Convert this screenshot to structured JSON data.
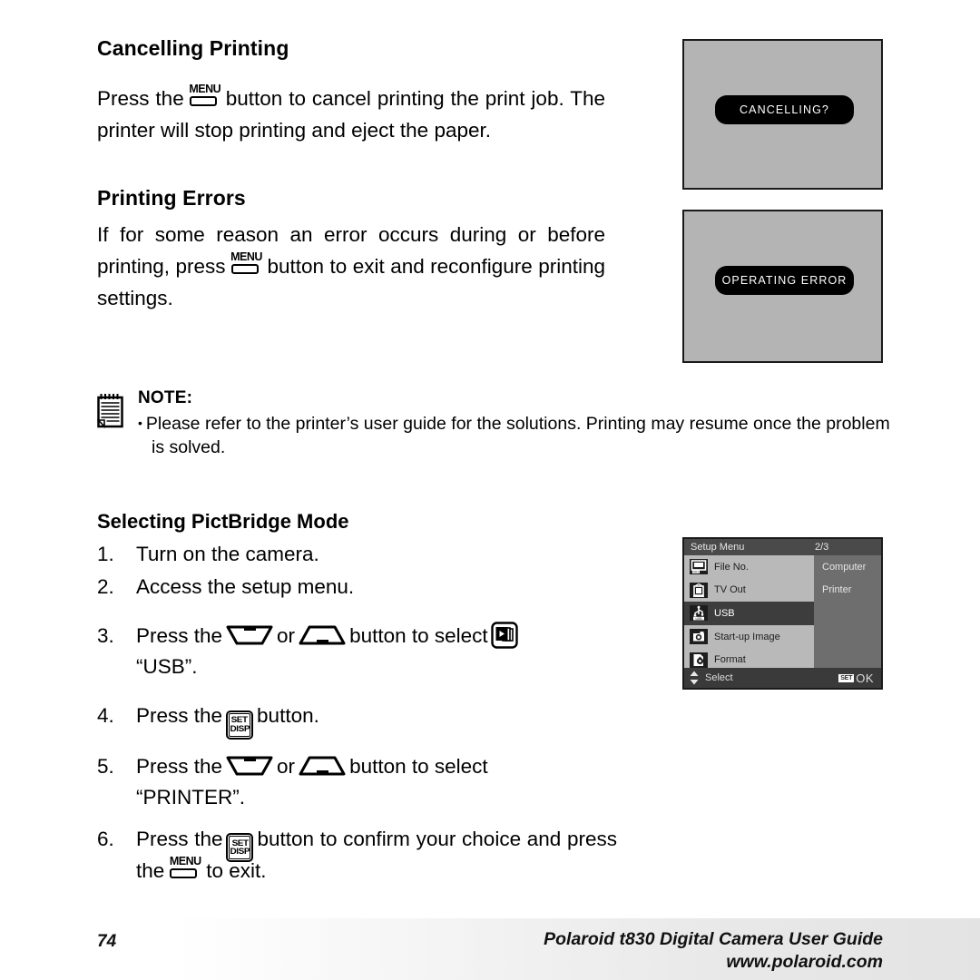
{
  "page": {
    "number": "74"
  },
  "sections": {
    "cancelling": {
      "title": "Cancelling Printing",
      "text_a": "Press the",
      "text_b": "button to cancel printing the print job. The printer will stop printing and eject the paper."
    },
    "errors": {
      "title": "Printing Errors",
      "text_a": "If for some reason an error occurs during or before printing, press",
      "text_b": "button to exit and reconfigure printing settings."
    },
    "note": {
      "title": "NOTE:",
      "bullet": "•",
      "text": "Please refer to the printer’s user guide for the solutions. Printing may resume once the problem is solved."
    },
    "pictbridge": {
      "title": "Selecting PictBridge Mode",
      "steps": [
        {
          "num": "1.",
          "text": "Turn on the camera."
        },
        {
          "num": "2.",
          "text": "Access the setup menu."
        },
        {
          "num": "3.",
          "pre": "Press the",
          "mid": "or",
          "post": "button to select",
          "cont": "“USB”."
        },
        {
          "num": "4.",
          "pre": "Press the",
          "post": "button."
        },
        {
          "num": "5.",
          "pre": "Press the",
          "mid": "or",
          "post": "button to select",
          "cont": "“PRINTER”."
        },
        {
          "num": "6.",
          "pre": "Press the",
          "post": "button to confirm your choice and press the",
          "tail": "to exit."
        }
      ]
    }
  },
  "icons": {
    "menu_label": "MENU",
    "set_label": "SET",
    "disp_label": "DISP"
  },
  "lcd_screens": {
    "cancelling": {
      "message": "CANCELLING?"
    },
    "error": {
      "message": "OPERATING ERROR"
    }
  },
  "setup_menu": {
    "title": "Setup Menu",
    "page_indicator": "2/3",
    "items": [
      {
        "label": "File No.",
        "icon": "file-number-icon",
        "selected": false
      },
      {
        "label": "TV Out",
        "icon": "tv-out-icon",
        "selected": false
      },
      {
        "label": "USB",
        "icon": "usb-icon",
        "selected": true
      },
      {
        "label": "Start-up  Image",
        "icon": "startup-image-icon",
        "selected": false
      },
      {
        "label": "Format",
        "icon": "format-icon",
        "selected": false
      }
    ],
    "options": [
      "Computer",
      "Printer"
    ],
    "footer": {
      "select_label": "Select",
      "set_badge": "SET",
      "ok_label": "OK"
    }
  },
  "footer": {
    "page_number": "74",
    "guide_title": "Polaroid t830 Digital Camera User Guide",
    "website": "www.polaroid.com"
  },
  "colors": {
    "lcd_background": "#b4b4b4",
    "lcd_message_bg": "#000000",
    "menu_titlebar": "#4a4a4a",
    "menu_left_col": "#b9b9b9",
    "menu_right_col": "#6e6e6e",
    "menu_selected": "#3d3d3d"
  }
}
